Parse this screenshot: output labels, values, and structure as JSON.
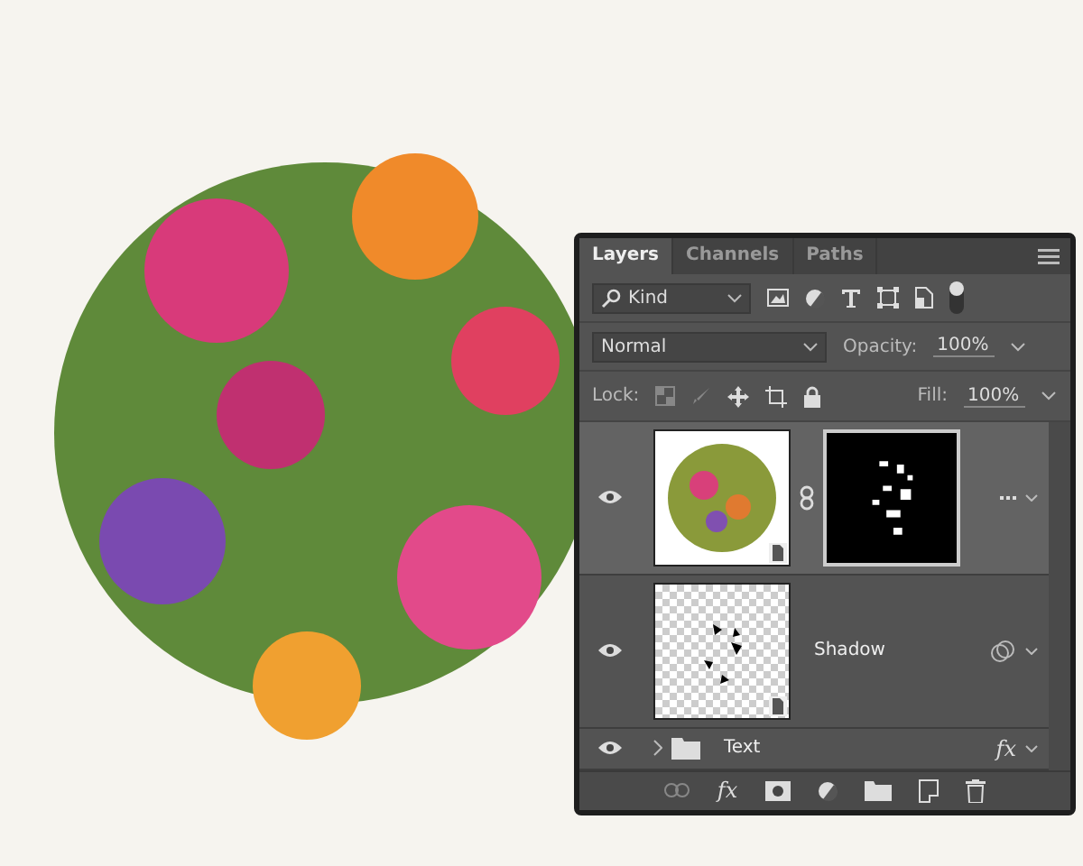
{
  "tabs": [
    {
      "label": "Layers",
      "selected": true
    },
    {
      "label": "Channels",
      "selected": false
    },
    {
      "label": "Paths",
      "selected": false
    }
  ],
  "filter": {
    "value": "Kind"
  },
  "blend_mode": {
    "value": "Normal"
  },
  "opacity": {
    "label": "Opacity:",
    "value": "100%"
  },
  "lock": {
    "label": "Lock:"
  },
  "fill": {
    "label": "Fill:",
    "value": "100%"
  },
  "layers": [
    {
      "kind": "masked",
      "visible": true,
      "selected": true
    },
    {
      "kind": "smart",
      "name": "Shadow",
      "visible": true,
      "selected": false
    },
    {
      "kind": "group",
      "name": "Text",
      "visible": true,
      "selected": false,
      "expanded": false,
      "effects": "fx"
    }
  ],
  "footer": {
    "effects": "fx"
  }
}
